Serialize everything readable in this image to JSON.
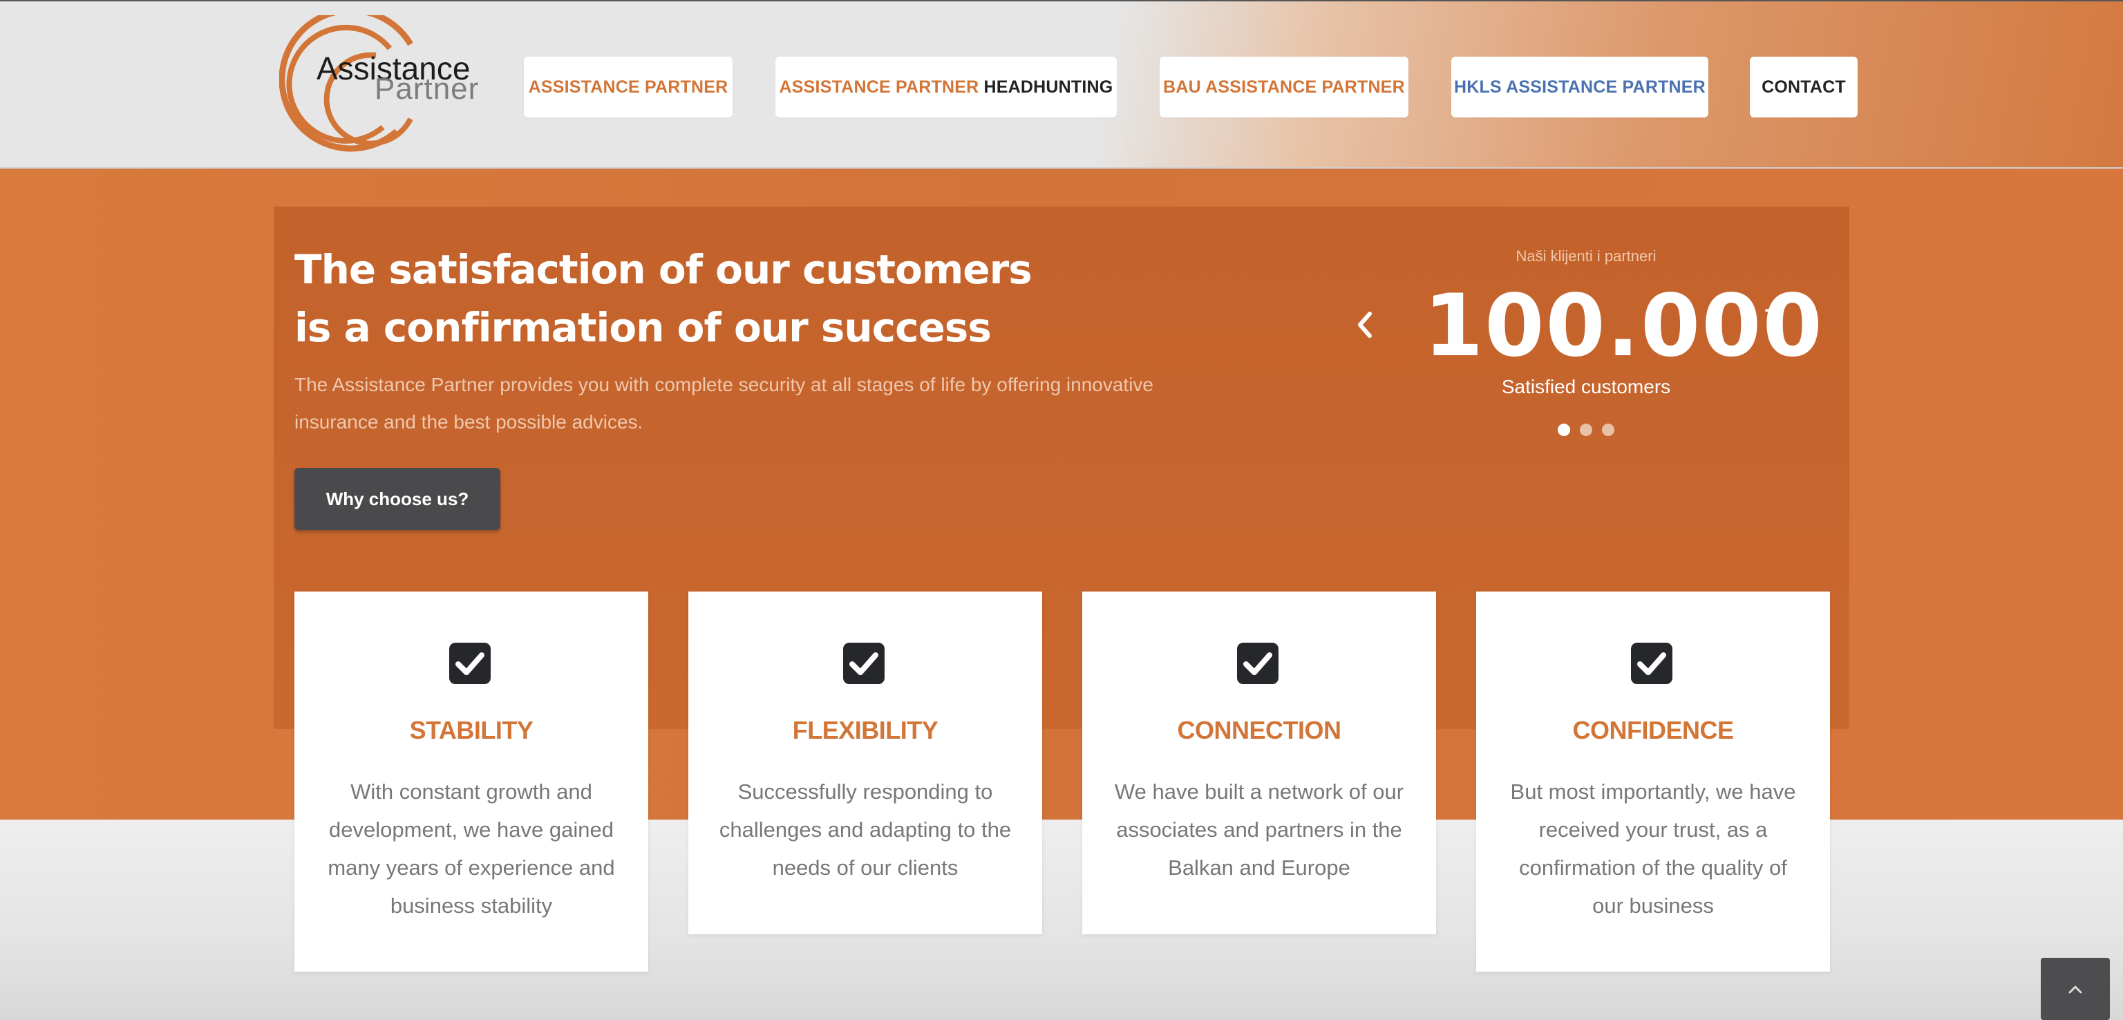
{
  "logo": {
    "word1": "Assistance",
    "word2": "Partner"
  },
  "nav": {
    "item1": "ASSISTANCE PARTNER",
    "item2_orange": "ASSISTANCE PARTNER",
    "item2_dark": "HEADHUNTING",
    "item3": "BAU ASSISTANCE PARTNER",
    "item4": "HKLS ASSISTANCE PARTNER",
    "item5": "CONTACT"
  },
  "hero": {
    "title_line1": "The satisfaction of our customers",
    "title_line2": "is a confirmation of our success",
    "description": "The Assistance Partner provides you with complete security at all stages of life by offering innovative insurance and the best possible advices.",
    "button": "Why choose us?"
  },
  "stats": {
    "label": "Naši klijenti i partneri",
    "number": "100.000",
    "plus": "+",
    "caption": "Satisfied customers",
    "slides": 3,
    "active_slide": 1
  },
  "cards": [
    {
      "title": "STABILITY",
      "text": "With constant growth and development, we have gained many years of experience and business stability"
    },
    {
      "title": "FLEXIBILITY",
      "text": "Successfully responding to challenges and adapting to the needs of our clients"
    },
    {
      "title": "CONNECTION",
      "text": "We have built a network of our associates and partners in the Balkan and Europe"
    },
    {
      "title": "CONFIDENCE",
      "text": "But most importantly, we have received your trust, as a confirmation of the quality of our business"
    }
  ],
  "icons": {
    "card_icon": "checkbox-checked-icon",
    "scroll": "chevron-up-icon",
    "prev": "chevron-left-icon",
    "next": "chevron-right-icon"
  },
  "colors": {
    "brand_orange": "#d27537",
    "hero_box": "#c4622b",
    "button_dark": "#4a4a4c",
    "nav_blue": "#4a72b0"
  }
}
